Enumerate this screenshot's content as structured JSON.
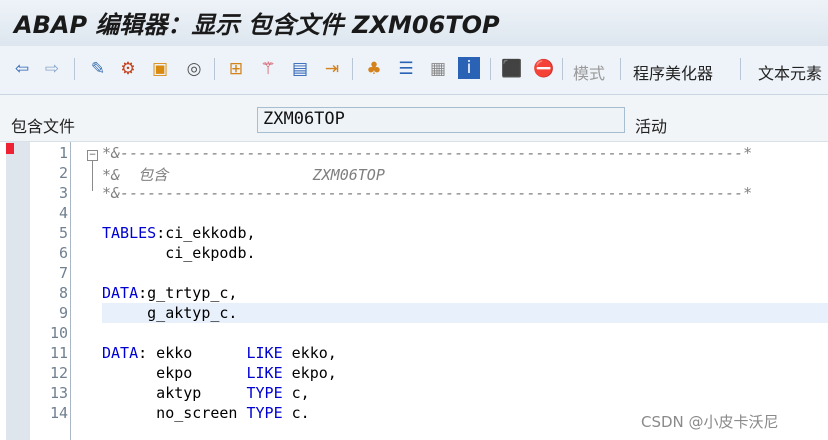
{
  "window": {
    "title": "ABAP 编辑器：显示 包含文件 ZXM06TOP"
  },
  "toolbar": {
    "icons": [
      "back-icon",
      "forward-icon",
      "check-syntax-icon",
      "object-list-icon",
      "create-object-icon",
      "where-used-icon",
      "hierarchy-icon",
      "wand-icon",
      "display-object-list-icon",
      "pretty-printer-icon",
      "navigation-icon",
      "tree-icon",
      "text-elements-icon",
      "book-icon",
      "info-icon",
      "debug-icon",
      "stop-icon"
    ],
    "mode_label": "模式",
    "pretty_printer_label": "程序美化器",
    "text_elements_label": "文本元素"
  },
  "include": {
    "label": "包含文件",
    "value": "ZXM06TOP",
    "status": "活动"
  },
  "editor": {
    "line_numbers": [
      "1",
      "2",
      "3",
      "4",
      "5",
      "6",
      "7",
      "8",
      "9",
      "10",
      "11",
      "12",
      "13",
      "14"
    ],
    "lines": [
      {
        "parts": [
          {
            "t": "*&---------------------------------------------------------------------*",
            "c": "cm"
          }
        ]
      },
      {
        "parts": [
          {
            "t": "*&  包含                ZXM06TOP",
            "c": "cm"
          }
        ]
      },
      {
        "parts": [
          {
            "t": "*&---------------------------------------------------------------------*",
            "c": "cm"
          }
        ]
      },
      {
        "parts": []
      },
      {
        "parts": [
          {
            "t": "TABLES",
            "c": "kw"
          },
          {
            "t": ":ci_ekkodb,",
            "c": ""
          }
        ]
      },
      {
        "parts": [
          {
            "t": "       ci_ekpodb.",
            "c": ""
          }
        ]
      },
      {
        "parts": []
      },
      {
        "parts": [
          {
            "t": "DATA",
            "c": "kw"
          },
          {
            "t": ":g_trtyp_c,",
            "c": ""
          }
        ]
      },
      {
        "parts": [
          {
            "t": "     g_aktyp_c.",
            "c": ""
          }
        ]
      },
      {
        "parts": []
      },
      {
        "parts": [
          {
            "t": "DATA",
            "c": "kw"
          },
          {
            "t": ": ekko      ",
            "c": ""
          },
          {
            "t": "LIKE",
            "c": "kw"
          },
          {
            "t": " ekko,",
            "c": ""
          }
        ]
      },
      {
        "parts": [
          {
            "t": "      ekpo      ",
            "c": ""
          },
          {
            "t": "LIKE",
            "c": "kw"
          },
          {
            "t": " ekpo,",
            "c": ""
          }
        ]
      },
      {
        "parts": [
          {
            "t": "      aktyp     ",
            "c": ""
          },
          {
            "t": "TYPE",
            "c": "kw"
          },
          {
            "t": " c,",
            "c": ""
          }
        ]
      },
      {
        "parts": [
          {
            "t": "      no_screen ",
            "c": ""
          },
          {
            "t": "TYPE",
            "c": "kw"
          },
          {
            "t": " c.",
            "c": ""
          }
        ]
      }
    ]
  },
  "watermark": "CSDN @小皮卡沃尼"
}
